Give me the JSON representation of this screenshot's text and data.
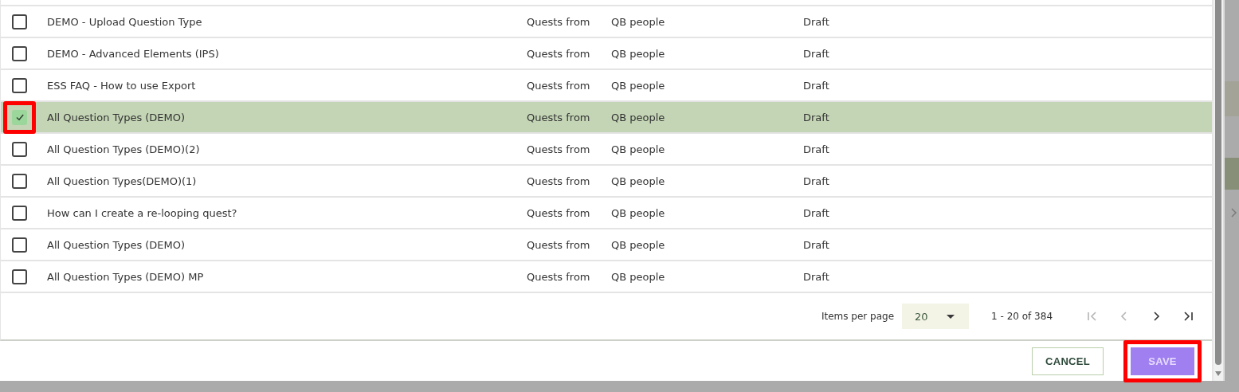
{
  "table": {
    "rows": [
      {
        "title": "DEMO - Upload Question Type",
        "column_3": "Quests from",
        "column_4": "QB people",
        "status": "Draft",
        "checked": false,
        "selected": false,
        "highlighted": false
      },
      {
        "title": "DEMO - Advanced Elements (IPS)",
        "column_3": "Quests from",
        "column_4": "QB people",
        "status": "Draft",
        "checked": false,
        "selected": false,
        "highlighted": false
      },
      {
        "title": "ESS FAQ - How to use Export",
        "column_3": "Quests from",
        "column_4": "QB people",
        "status": "Draft",
        "checked": false,
        "selected": false,
        "highlighted": false
      },
      {
        "title": "All Question Types (DEMO)",
        "column_3": "Quests from",
        "column_4": "QB people",
        "status": "Draft",
        "checked": true,
        "selected": true,
        "highlighted": true
      },
      {
        "title": "All Question Types (DEMO)(2)",
        "column_3": "Quests from",
        "column_4": "QB people",
        "status": "Draft",
        "checked": false,
        "selected": false,
        "highlighted": false
      },
      {
        "title": "All Question Types(DEMO)(1)",
        "column_3": "Quests from",
        "column_4": "QB people",
        "status": "Draft",
        "checked": false,
        "selected": false,
        "highlighted": false
      },
      {
        "title": "How can I create a re-looping quest?",
        "column_3": "Quests from",
        "column_4": "QB people",
        "status": "Draft",
        "checked": false,
        "selected": false,
        "highlighted": false
      },
      {
        "title": "All Question Types (DEMO)",
        "column_3": "Quests from",
        "column_4": "QB people",
        "status": "Draft",
        "checked": false,
        "selected": false,
        "highlighted": false
      },
      {
        "title": "All Question Types (DEMO) MP",
        "column_3": "Quests from",
        "column_4": "QB people",
        "status": "Draft",
        "checked": false,
        "selected": false,
        "highlighted": false
      }
    ]
  },
  "paginator": {
    "label": "Items per page",
    "page_size": "20",
    "range": "1 - 20 of 384",
    "first_disabled": true,
    "previous_disabled": true,
    "next_disabled": false,
    "last_disabled": false
  },
  "buttons": [
    {
      "label": "CANCEL",
      "kind": "secondary",
      "highlighted": false
    },
    {
      "label": "SAVE",
      "kind": "primary",
      "highlighted": true
    }
  ]
}
